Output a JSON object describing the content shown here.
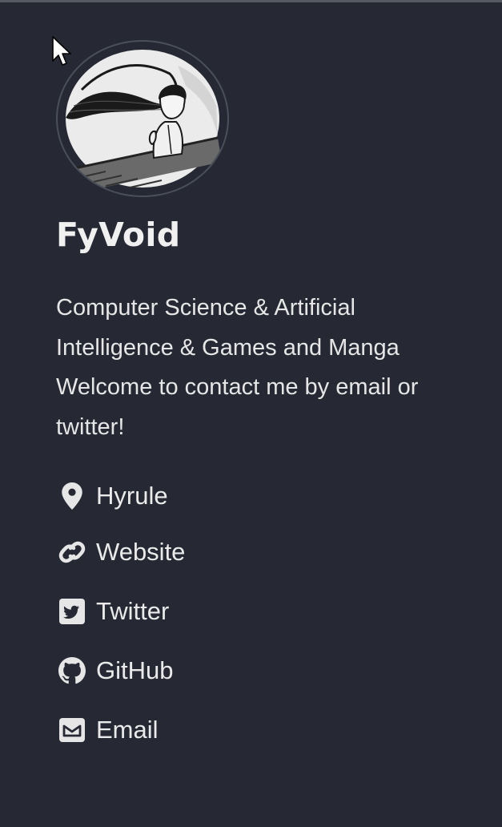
{
  "profile": {
    "name": "FyVoid",
    "bio_lines": [
      "Computer Science & Artificial",
      "Intelligence & Games and Manga",
      "Welcome to contact me by email or",
      "twitter!"
    ]
  },
  "links": [
    {
      "label": "Hyrule",
      "icon": "map-pin-icon"
    },
    {
      "label": "Website",
      "icon": "link-icon"
    },
    {
      "label": "Twitter",
      "icon": "twitter-icon"
    },
    {
      "label": "GitHub",
      "icon": "github-icon"
    },
    {
      "label": "Email",
      "icon": "envelope-icon"
    }
  ],
  "colors": {
    "background": "#262933",
    "text": "#e6e6e6",
    "avatar_border": "#4a4f5a"
  }
}
